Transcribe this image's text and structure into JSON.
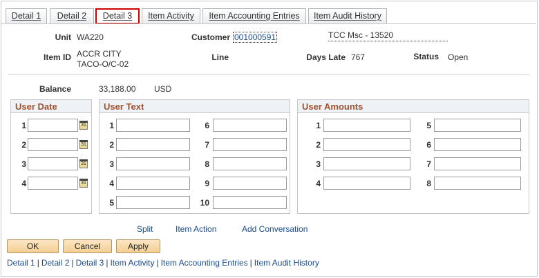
{
  "tabs": [
    {
      "label": "Detail 1",
      "active": false
    },
    {
      "label": "Detail 2",
      "active": false
    },
    {
      "label": "Detail 3",
      "active": true
    },
    {
      "label": "Item Activity",
      "active": false
    },
    {
      "label": "Item Accounting Entries",
      "active": false
    },
    {
      "label": "Item Audit History",
      "active": false
    }
  ],
  "header": {
    "unit_label": "Unit",
    "unit_value": "WA220",
    "customer_label": "Customer",
    "customer_value": "001000591",
    "customer_name": "TCC Msc - 13520",
    "item_id_label": "Item ID",
    "item_id_line1": "ACCR CITY",
    "item_id_line2": "TACO-O/C-02",
    "line_label": "Line",
    "days_late_label": "Days Late",
    "days_late_value": "767",
    "status_label": "Status",
    "status_value": "Open",
    "balance_label": "Balance",
    "balance_value": "33,188.00",
    "currency": "USD"
  },
  "user_date": {
    "title": "User Date",
    "rows": [
      "1",
      "2",
      "3",
      "4"
    ]
  },
  "user_text": {
    "title": "User Text",
    "left": [
      "1",
      "2",
      "3",
      "4",
      "5"
    ],
    "right": [
      "6",
      "7",
      "8",
      "9",
      "10"
    ]
  },
  "user_amounts": {
    "title": "User Amounts",
    "left": [
      "1",
      "2",
      "3",
      "4"
    ],
    "right": [
      "5",
      "6",
      "7",
      "8"
    ]
  },
  "links": {
    "split": "Split",
    "item_action": "Item Action",
    "add_conversation": "Add Conversation"
  },
  "buttons": {
    "ok": "OK",
    "cancel": "Cancel",
    "apply": "Apply"
  },
  "footer_links": [
    "Detail 1",
    "Detail 2",
    "Detail 3",
    "Item Activity",
    "Item Accounting Entries",
    "Item Audit History"
  ],
  "icons": {
    "calendar": "calendar-icon"
  },
  "colors": {
    "group_title": "#a0522d",
    "active_tab_border": "#cc0000",
    "link": "#1a4b8c",
    "button": "#f3cf93"
  }
}
